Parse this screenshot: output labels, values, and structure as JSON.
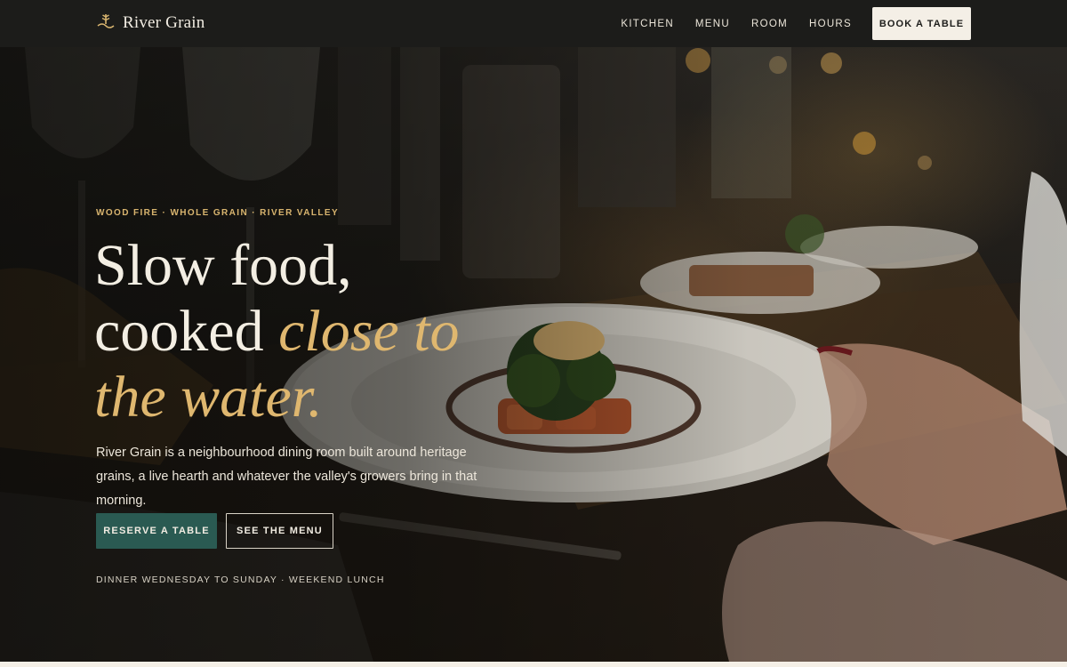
{
  "nav": {
    "brand_name": "River Grain",
    "links": [
      "KITCHEN",
      "MENU",
      "ROOM",
      "HOURS"
    ],
    "book_label": "BOOK A TABLE"
  },
  "hero": {
    "eyebrow": "WOOD FIRE · WHOLE GRAIN · RIVER VALLEY",
    "headline_line1": "Slow food,",
    "headline_line2_plain": "cooked ",
    "headline_line2_accent": "close to",
    "headline_line3_accent": "the water.",
    "lede": "River Grain is a neighbourhood dining room built around heritage grains, a live hearth and whatever the valley's growers bring in that morning.",
    "primary_cta": "RESERVE A TABLE",
    "secondary_cta": "SEE THE MENU",
    "hours_note": "DINNER WEDNESDAY TO SUNDAY · WEEKEND LUNCH"
  },
  "colors": {
    "accent_gold": "#dfb76f",
    "primary_green": "#2a5a52",
    "nav_bg": "#1c1c1a",
    "cream": "#f4efe6"
  },
  "icons": {
    "brand_mark": "wheat-sprig-icon"
  }
}
